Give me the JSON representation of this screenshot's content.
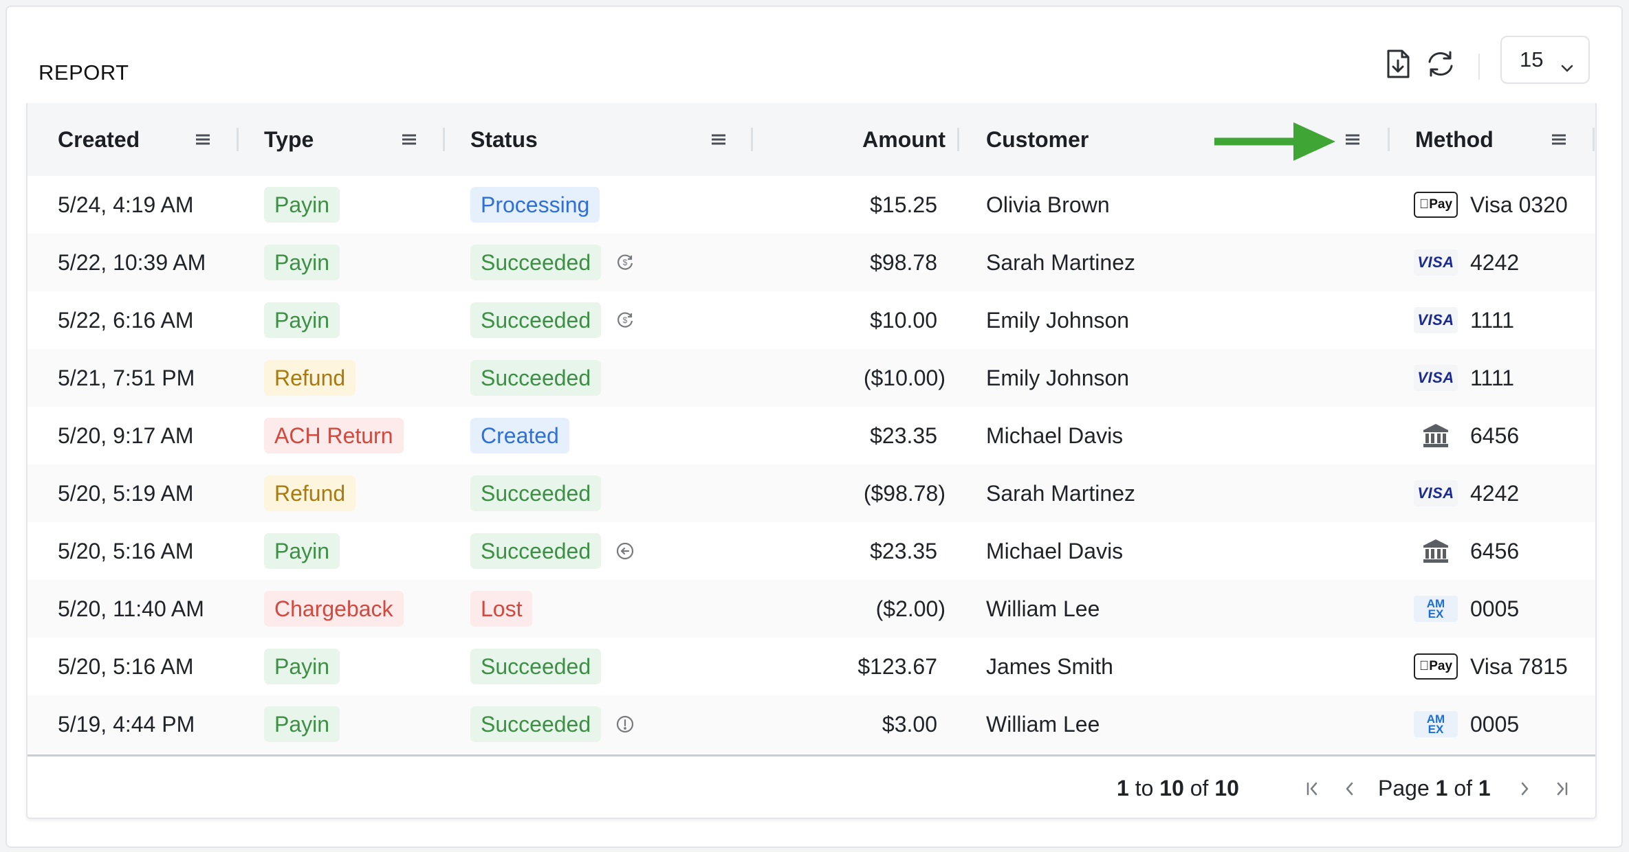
{
  "report": {
    "title": "REPORT",
    "page_size": "15",
    "export_icon": "download-file-icon",
    "refresh_icon": "refresh-icon"
  },
  "columns": {
    "created": "Created",
    "type": "Type",
    "status": "Status",
    "amount": "Amount",
    "customer": "Customer",
    "method": "Method"
  },
  "rows": [
    {
      "created": "5/24, 4:19 AM",
      "type": "Payin",
      "type_color": "green",
      "status": "Processing",
      "status_color": "blue",
      "status_icon": "",
      "amount": "$15.25",
      "customer": "Olivia Brown",
      "method_logo": "applepay",
      "method": "Visa 0320"
    },
    {
      "created": "5/22, 10:39 AM",
      "type": "Payin",
      "type_color": "green",
      "status": "Succeeded",
      "status_color": "green",
      "status_icon": "refund-dollar-icon",
      "amount": "$98.78",
      "customer": "Sarah Martinez",
      "method_logo": "visa",
      "method": "4242"
    },
    {
      "created": "5/22, 6:16 AM",
      "type": "Payin",
      "type_color": "green",
      "status": "Succeeded",
      "status_color": "green",
      "status_icon": "refund-dollar-icon",
      "amount": "$10.00",
      "customer": "Emily Johnson",
      "method_logo": "visa",
      "method": "1111"
    },
    {
      "created": "5/21, 7:51 PM",
      "type": "Refund",
      "type_color": "yellow",
      "status": "Succeeded",
      "status_color": "green",
      "status_icon": "",
      "amount": "($10.00)",
      "customer": "Emily Johnson",
      "method_logo": "visa",
      "method": "1111"
    },
    {
      "created": "5/20, 9:17 AM",
      "type": "ACH Return",
      "type_color": "red",
      "status": "Created",
      "status_color": "blue",
      "status_icon": "",
      "amount": "$23.35",
      "customer": "Michael Davis",
      "method_logo": "bank",
      "method": "6456"
    },
    {
      "created": "5/20, 5:19 AM",
      "type": "Refund",
      "type_color": "yellow",
      "status": "Succeeded",
      "status_color": "green",
      "status_icon": "",
      "amount": "($98.78)",
      "customer": "Sarah Martinez",
      "method_logo": "visa",
      "method": "4242"
    },
    {
      "created": "5/20, 5:16 AM",
      "type": "Payin",
      "type_color": "green",
      "status": "Succeeded",
      "status_color": "green",
      "status_icon": "return-arrow-icon",
      "amount": "$23.35",
      "customer": "Michael Davis",
      "method_logo": "bank",
      "method": "6456"
    },
    {
      "created": "5/20, 11:40 AM",
      "type": "Chargeback",
      "type_color": "red",
      "status": "Lost",
      "status_color": "red",
      "status_icon": "",
      "amount": "($2.00)",
      "customer": "William Lee",
      "method_logo": "amex",
      "method": "0005"
    },
    {
      "created": "5/20, 5:16 AM",
      "type": "Payin",
      "type_color": "green",
      "status": "Succeeded",
      "status_color": "green",
      "status_icon": "",
      "amount": "$123.67",
      "customer": "James Smith",
      "method_logo": "applepay",
      "method": "Visa 7815"
    },
    {
      "created": "5/19, 4:44 PM",
      "type": "Payin",
      "type_color": "green",
      "status": "Succeeded",
      "status_color": "green",
      "status_icon": "info-icon",
      "amount": "$3.00",
      "customer": "William Lee",
      "method_logo": "amex",
      "method": "0005"
    }
  ],
  "logos": {
    "applepay": "Pay",
    "visa": "VISA",
    "amex_top": "AM",
    "amex_bottom": "EX"
  },
  "footer": {
    "range_from": "1",
    "range_to_word": "to",
    "range_to": "10",
    "range_of_word": "of",
    "range_total": "10",
    "page_word": "Page",
    "page_current": "1",
    "page_of_word": "of",
    "page_total": "1"
  },
  "colors": {
    "annotation_arrow": "#3fa535"
  }
}
